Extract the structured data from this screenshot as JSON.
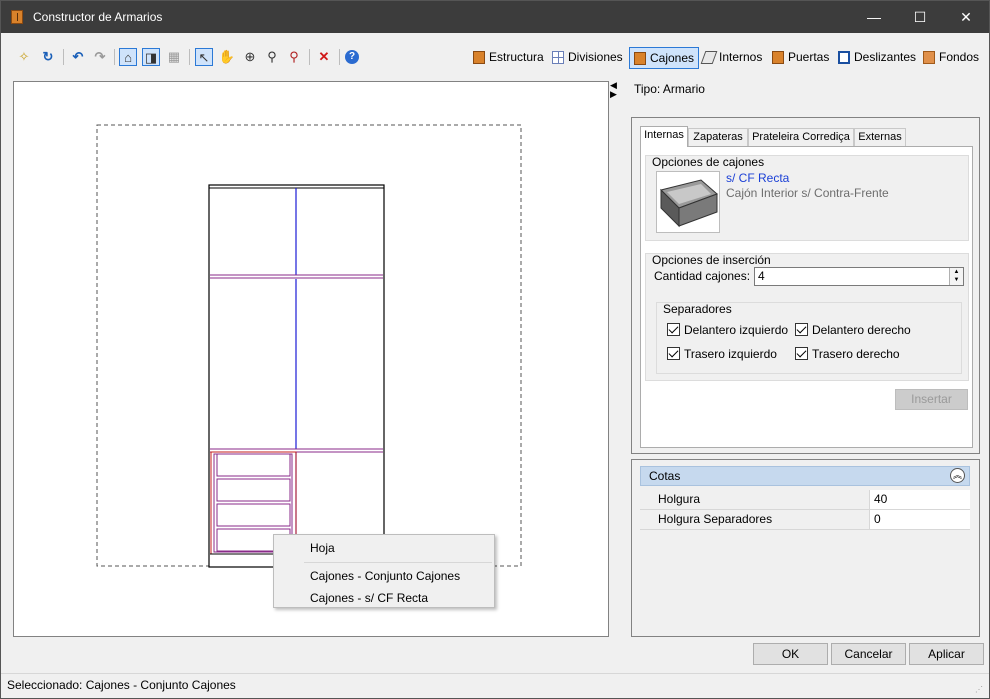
{
  "window": {
    "title": "Constructor de Armarios",
    "controls": {
      "minimize": "—",
      "maximize": "☐",
      "close": "✕"
    }
  },
  "toolbar": {
    "tools": [
      {
        "name": "new-icon",
        "glyph": "✧"
      },
      {
        "name": "refresh-icon",
        "glyph": "↻"
      },
      {
        "name": "undo-icon",
        "glyph": "↶"
      },
      {
        "name": "redo-icon",
        "glyph": "↷"
      },
      {
        "name": "view-front-icon",
        "glyph": "⌂"
      },
      {
        "name": "view-side-icon",
        "glyph": "◨"
      },
      {
        "name": "grid-icon",
        "glyph": "▦"
      },
      {
        "name": "pointer-icon",
        "glyph": "↖"
      },
      {
        "name": "pan-hand-icon",
        "glyph": "✋"
      },
      {
        "name": "zoom-extents-icon",
        "glyph": "⊕"
      },
      {
        "name": "zoom-in-icon",
        "glyph": "⚲"
      },
      {
        "name": "zoom-window-icon",
        "glyph": "⚲"
      },
      {
        "name": "delete-icon",
        "glyph": "✕"
      },
      {
        "name": "help-icon",
        "glyph": "?"
      }
    ],
    "categories": [
      {
        "label": "Estructura",
        "color": "#d9822b"
      },
      {
        "label": "Divisiones",
        "color": "#6a7fb8"
      },
      {
        "label": "Cajones",
        "color": "#d9822b"
      },
      {
        "label": "Internos",
        "color": "#555555"
      },
      {
        "label": "Puertas",
        "color": "#d9822b"
      },
      {
        "label": "Deslizantes",
        "color": "#1a4fa0"
      },
      {
        "label": "Fondos",
        "color": "#e0904a"
      }
    ],
    "active_category": "Cajones"
  },
  "context_menu": {
    "items": [
      "Hoja",
      "Cajones - Conjunto Cajones",
      "Cajones - s/ CF Recta"
    ]
  },
  "properties": {
    "tipo": "Tipo: Armario",
    "tabs": [
      "Internas",
      "Zapateras",
      "Prateleira Corrediça",
      "Externas"
    ],
    "active_tab": "Internas",
    "opciones_cajones": {
      "title": "Opciones de cajones",
      "item_title": "s/ CF Recta",
      "item_subtitle": "Cajón Interior s/ Contra-Frente"
    },
    "opciones_insercion": {
      "title": "Opciones de inserción",
      "cantidad_label": "Cantidad cajones:",
      "cantidad_value": "4",
      "separadores_title": "Separadores",
      "checks": [
        {
          "label": "Delantero izquierdo",
          "checked": true
        },
        {
          "label": "Delantero derecho",
          "checked": true
        },
        {
          "label": "Trasero izquierdo",
          "checked": true
        },
        {
          "label": "Trasero derecho",
          "checked": true
        }
      ],
      "insert_button": "Insertar"
    }
  },
  "cotas": {
    "title": "Cotas",
    "rows": [
      {
        "name": "Holgura",
        "value": "40"
      },
      {
        "name": "Holgura Separadores",
        "value": "0"
      }
    ]
  },
  "buttons": {
    "ok": "OK",
    "cancel": "Cancelar",
    "apply": "Aplicar"
  },
  "status": {
    "text": "Seleccionado: Cajones - Conjunto Cajones"
  },
  "colors": {
    "titlebar": "#3c3c3c",
    "selection_blue": "#2b79d6",
    "division_blue": "#1a1ad6",
    "drawer_purple": "#8a2a8a",
    "drawer_red": "#c41e1e",
    "link_blue": "#1a3fd6"
  }
}
